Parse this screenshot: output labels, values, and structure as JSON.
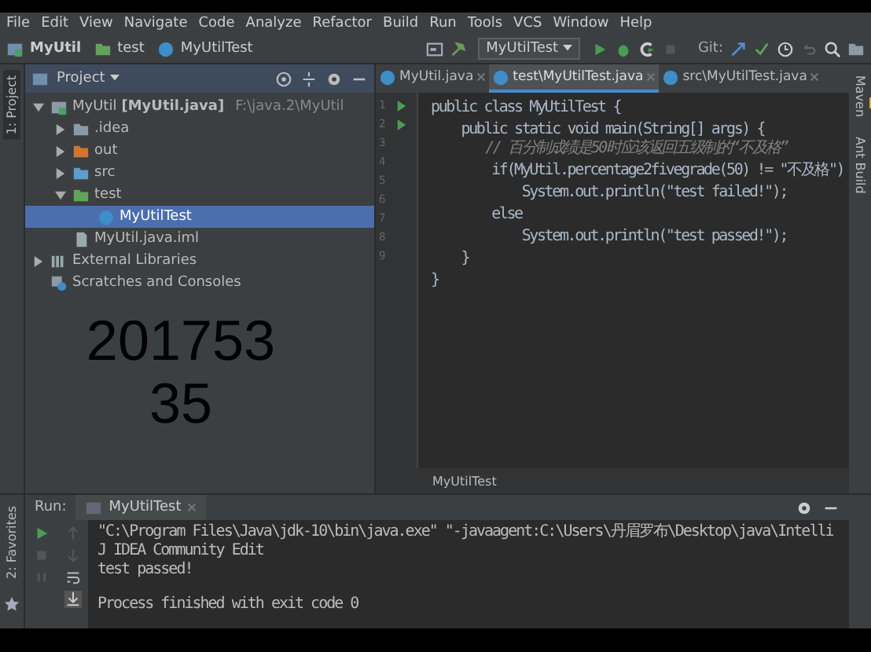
{
  "menu": [
    "File",
    "Edit",
    "View",
    "Navigate",
    "Code",
    "Analyze",
    "Refactor",
    "Build",
    "Run",
    "Tools",
    "VCS",
    "Window",
    "Help"
  ],
  "breadcrumbs": [
    {
      "label": "MyUtil",
      "kind": "module"
    },
    {
      "label": "test",
      "kind": "folder"
    },
    {
      "label": "MyUtilTest",
      "kind": "class"
    }
  ],
  "run_config": "MyUtilTest",
  "git_label": "Git:",
  "left_strip": "1: Project",
  "project_panel": {
    "title": "Project",
    "tree": [
      {
        "label": "MyUtil",
        "bold": "[MyUtil.java]",
        "path": "F:\\java.2\\MyUtil",
        "kind": "module",
        "expanded": true,
        "selected": false,
        "children": [
          {
            "label": ".idea",
            "kind": "folder",
            "expanded": false,
            "selected": false
          },
          {
            "label": "out",
            "kind": "out",
            "expanded": false,
            "selected": false
          },
          {
            "label": "src",
            "kind": "src",
            "expanded": false,
            "selected": false
          },
          {
            "label": "test",
            "kind": "test",
            "expanded": true,
            "selected": false,
            "children": [
              {
                "label": "MyUtilTest",
                "kind": "class",
                "selected": true
              }
            ]
          },
          {
            "label": "MyUtil.java.iml",
            "kind": "file",
            "selected": false
          }
        ]
      },
      {
        "label": "External Libraries",
        "kind": "lib",
        "expanded": false,
        "selected": false
      },
      {
        "label": "Scratches and Consoles",
        "kind": "scratch",
        "selected": false
      }
    ]
  },
  "overlay_number": [
    "201753",
    "35"
  ],
  "editor": {
    "tabs": [
      {
        "label": "MyUtil.java",
        "selected": false
      },
      {
        "label": "test\\MyUtilTest.java",
        "selected": true
      },
      {
        "label": "src\\MyUtilTest.java",
        "selected": false
      }
    ],
    "lines": [
      {
        "number": "1",
        "text": "public class MyUtilTest {",
        "kind": "code",
        "runnable": true
      },
      {
        "number": "2",
        "text": "    public static void main(String[] args) {",
        "kind": "code",
        "runnable": true
      },
      {
        "number": "3",
        "text": "        // 百分制成绩是50时应该返回五级制的“不及格”",
        "kind": "comment",
        "runnable": false
      },
      {
        "number": "4",
        "text": "        if(MyUtil.percentage2fivegrade(50) != \"不及格\")",
        "kind": "code",
        "runnable": false
      },
      {
        "number": "5",
        "text": "            System.out.println(\"test failed!\");",
        "kind": "code",
        "runnable": false
      },
      {
        "number": "6",
        "text": "        else",
        "kind": "code",
        "runnable": false
      },
      {
        "number": "7",
        "text": "            System.out.println(\"test passed!\");",
        "kind": "code",
        "runnable": false
      },
      {
        "number": "8",
        "text": "    }",
        "kind": "code",
        "runnable": false
      },
      {
        "number": "9",
        "text": "}",
        "kind": "code",
        "runnable": false
      }
    ],
    "breadcrumb": "MyUtilTest"
  },
  "right_strip": [
    "Maven",
    "Ant Build"
  ],
  "run_panel": {
    "label": "Run:",
    "tab": "MyUtilTest",
    "favorites": "2: Favorites",
    "output": [
      "\"C:\\Program Files\\Java\\jdk-10\\bin\\java.exe\" \"-javaagent:C:\\Users\\丹眉罗布\\Desktop\\java\\IntelliJ IDEA Community Edit",
      "test passed!",
      "Process finished with exit code 0"
    ]
  }
}
